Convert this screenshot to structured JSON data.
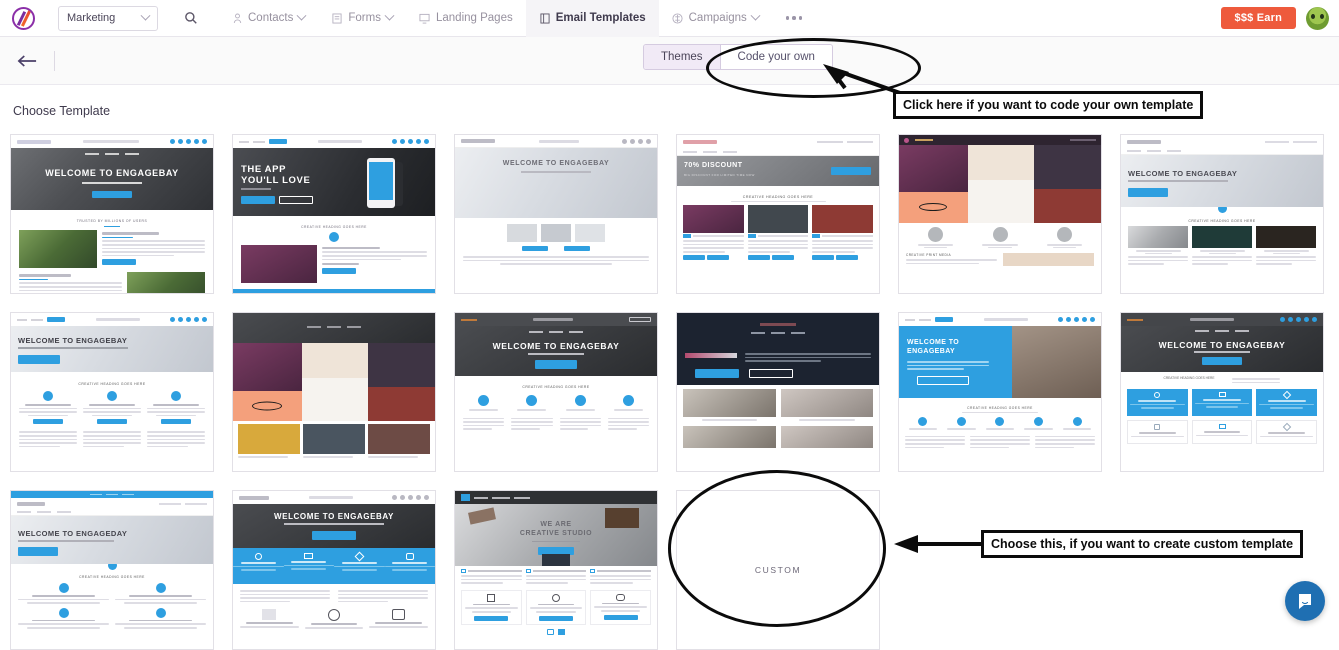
{
  "header": {
    "logo_name": "engagebay-logo",
    "workspace": {
      "label": "Marketing"
    },
    "search_icon": "search-icon",
    "nav": [
      {
        "label": "Contacts",
        "icon": "contacts-icon",
        "has_caret": true,
        "active": false
      },
      {
        "label": "Forms",
        "icon": "forms-icon",
        "has_caret": true,
        "active": false
      },
      {
        "label": "Landing Pages",
        "icon": "landing-pages-icon",
        "has_caret": false,
        "active": false
      },
      {
        "label": "Email Templates",
        "icon": "email-templates-icon",
        "has_caret": false,
        "active": true
      },
      {
        "label": "Campaigns",
        "icon": "campaigns-icon",
        "has_caret": true,
        "active": false
      }
    ],
    "overflow_label": "more-menu",
    "earn_button": "$$$ Earn",
    "avatar_name": "user-avatar",
    "accent_color": "#ee5a3c"
  },
  "subbar": {
    "back_label": "back-arrow",
    "tabs": [
      {
        "label": "Themes",
        "active": true
      },
      {
        "label": "Code your own",
        "active": false
      }
    ]
  },
  "page": {
    "title": "Choose Template"
  },
  "annotations": [
    {
      "type": "ellipse",
      "target": "code-your-own-tab"
    },
    {
      "type": "arrow",
      "target": "code-your-own-tab"
    },
    {
      "type": "callout",
      "text": "Click here if you want to code your own template"
    },
    {
      "type": "ellipse",
      "target": "custom-template-card"
    },
    {
      "type": "arrow",
      "target": "custom-template-card"
    },
    {
      "type": "callout",
      "text": "Choose this, if you want to create custom template"
    }
  ],
  "templates": [
    {
      "id": "t1",
      "name": "welcome-to-engagebay-plants",
      "headline": "WELCOME TO ENGAGEBAY",
      "variant": "hero-dark-photo"
    },
    {
      "id": "t2",
      "name": "the-app-youll-love",
      "headline": "THE APP\nYOU'LL LOVE",
      "variant": "app-dark"
    },
    {
      "id": "t3",
      "name": "welcome-to-engagebay-light",
      "headline": "WELCOME TO ENGAGEBAY",
      "variant": "hero-light"
    },
    {
      "id": "t4",
      "name": "seventy-percent-discount",
      "headline": "70% DISCOUNT",
      "subhead": "BIG DISCOUNT FOR LIMITED TIME NOW",
      "section": "CREATIVE HEADING GOES HERE",
      "variant": "discount"
    },
    {
      "id": "t5",
      "name": "creative-print-media-collage",
      "headline": "",
      "section": "CREATIVE PRINT MEDIA",
      "variant": "collage"
    },
    {
      "id": "t6",
      "name": "welcome-to-engagebay-tablet",
      "headline": "WELCOME TO ENGAGEBAY",
      "section": "CREATIVE HEADING GOES HERE",
      "variant": "hero-tablet"
    },
    {
      "id": "t7",
      "name": "welcome-to-engagebay-features",
      "headline": "WELCOME TO ENGAGEBAY",
      "section": "CREATIVE HEADING GOES HERE",
      "variant": "features-3col"
    },
    {
      "id": "t8",
      "name": "collage-portraits",
      "headline": "",
      "variant": "collage-portraits"
    },
    {
      "id": "t9",
      "name": "welcome-to-engagebay-dark",
      "headline": "WELCOME TO ENGAGEBAY",
      "section": "CREATIVE HEADING GOES HERE",
      "variant": "dark-hero-4col"
    },
    {
      "id": "t10",
      "name": "engagebay-night-gallery",
      "headline": "",
      "variant": "night-gallery"
    },
    {
      "id": "t11",
      "name": "welcome-to-engagebay-blue",
      "headline": "WELCOME TO\nENGAGEBAY",
      "section": "CREATIVE HEADING GOES HERE",
      "variant": "blue-split"
    },
    {
      "id": "t12",
      "name": "welcome-to-engagebay-cards",
      "headline": "WELCOME TO ENGAGEBAY",
      "section": "CREATIVE HEADING GOES HERE",
      "variant": "dark-hero-cards"
    },
    {
      "id": "t13",
      "name": "welcome-to-engageday-tablet",
      "headline": "WELCOME TO ENGAGEDAY",
      "section": "CREATIVE HEADING GOES HERE",
      "variant": "tablet-4grid"
    },
    {
      "id": "t14",
      "name": "welcome-to-engagebay-blueband",
      "headline": "WELCOME TO ENGAGEBAY",
      "variant": "blue-band"
    },
    {
      "id": "t15",
      "name": "we-are-creative-studio",
      "headline": "WE ARE\nCREATIVE STUDIO",
      "variant": "studio"
    },
    {
      "id": "t16",
      "name": "custom-template-card",
      "label": "CUSTOM",
      "variant": "custom"
    }
  ],
  "chat": {
    "name": "chat-launcher",
    "color": "#1f6fb2"
  }
}
